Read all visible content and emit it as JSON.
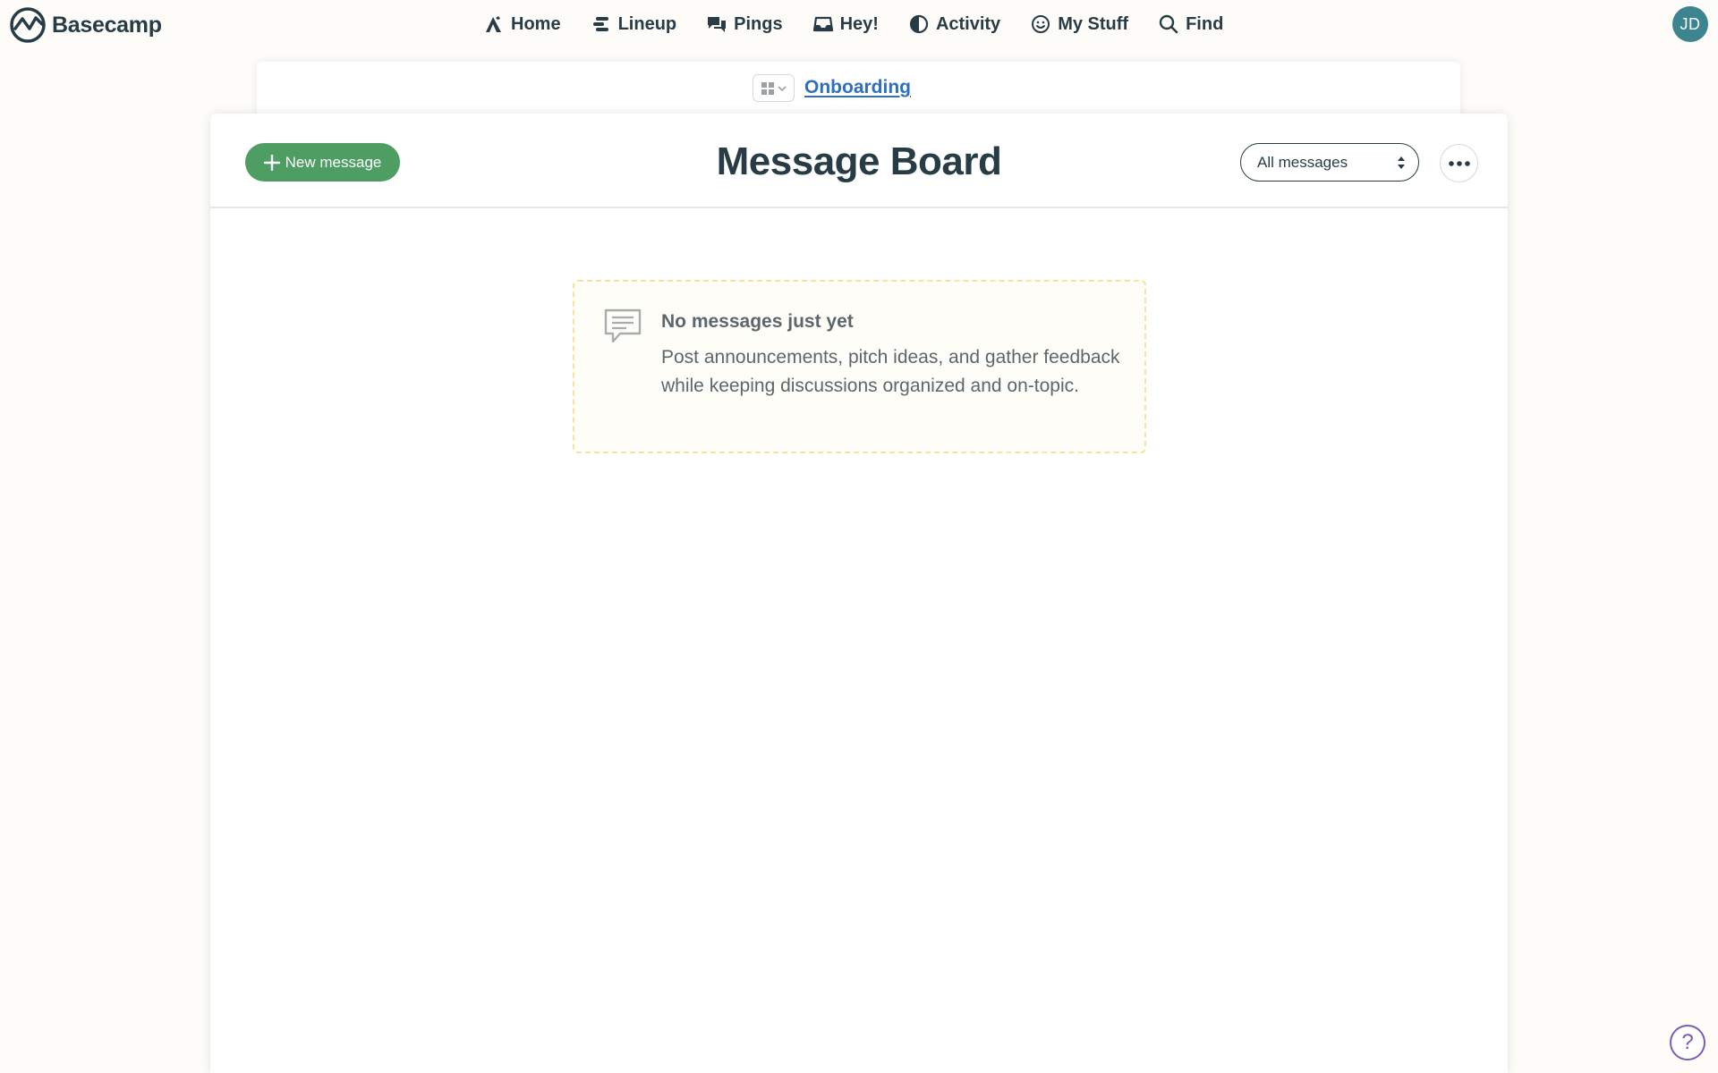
{
  "brand": {
    "name": "Basecamp"
  },
  "nav": {
    "items": [
      {
        "label": "Home",
        "icon": "home-icon"
      },
      {
        "label": "Lineup",
        "icon": "lineup-icon"
      },
      {
        "label": "Pings",
        "icon": "pings-icon"
      },
      {
        "label": "Hey!",
        "icon": "hey-inbox-icon"
      },
      {
        "label": "Activity",
        "icon": "activity-icon"
      },
      {
        "label": "My Stuff",
        "icon": "my-stuff-icon"
      },
      {
        "label": "Find",
        "icon": "search-icon"
      }
    ]
  },
  "user": {
    "initials": "JD",
    "avatar_color": "#3b8490"
  },
  "breadcrumb": {
    "project": "Onboarding"
  },
  "board": {
    "title": "Message Board",
    "new_message_label": "New message",
    "filter": {
      "selected": "All messages"
    }
  },
  "empty_state": {
    "title": "No messages just yet",
    "body": "Post announcements, pitch ideas, and gather feedback while keeping discussions organized and on-topic."
  },
  "help": {
    "label": "?"
  },
  "colors": {
    "accent_green": "#4e9d63",
    "link_blue": "#2f6fbd",
    "text_dark": "#283c46",
    "help_purple": "#7a5db0"
  }
}
